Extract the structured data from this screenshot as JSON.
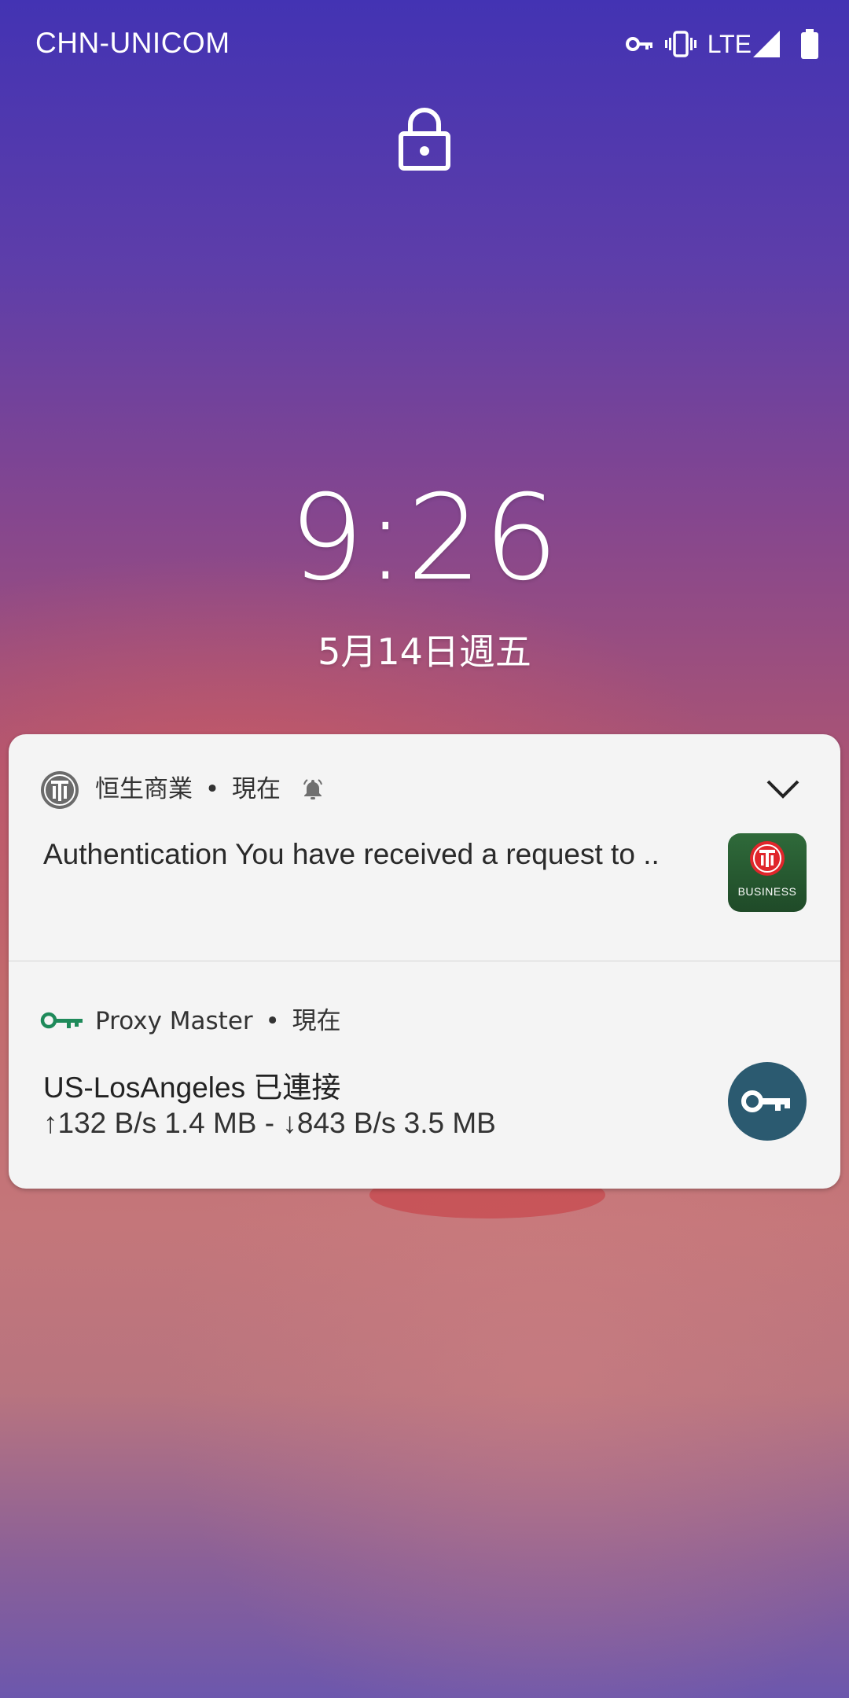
{
  "status_bar": {
    "carrier": "CHN-UNICOM",
    "network": "LTE",
    "icons": [
      "vpn-key-icon",
      "vibrate-icon",
      "signal-icon",
      "battery-icon"
    ]
  },
  "lockscreen": {
    "lock_icon": "lock-icon",
    "time": "9:26",
    "date": "5月14日週五"
  },
  "notifications": [
    {
      "app_name": "恒生商業",
      "time": "現在",
      "separator": "•",
      "icon": "hang-seng-logo-icon",
      "title": "Authentication",
      "text": "You have received a request to ..",
      "large_icon": "hang-seng-business-app-icon",
      "large_icon_label": "BUSINESS",
      "alert_icon": "bell-icon",
      "expand_icon": "chevron-down-icon"
    },
    {
      "app_name": "Proxy Master",
      "time": "現在",
      "separator": "•",
      "icon": "key-icon",
      "title": "US-LosAngeles 已連接",
      "upload_arrow": "↑",
      "upload_rate": "132 B/s",
      "upload_total": "1.4 MB",
      "dash": "-",
      "download_arrow": "↓",
      "download_rate": "843 B/s",
      "download_total": "3.5 MB",
      "large_icon": "key-icon",
      "accent_color": "#1e8a5a"
    }
  ]
}
